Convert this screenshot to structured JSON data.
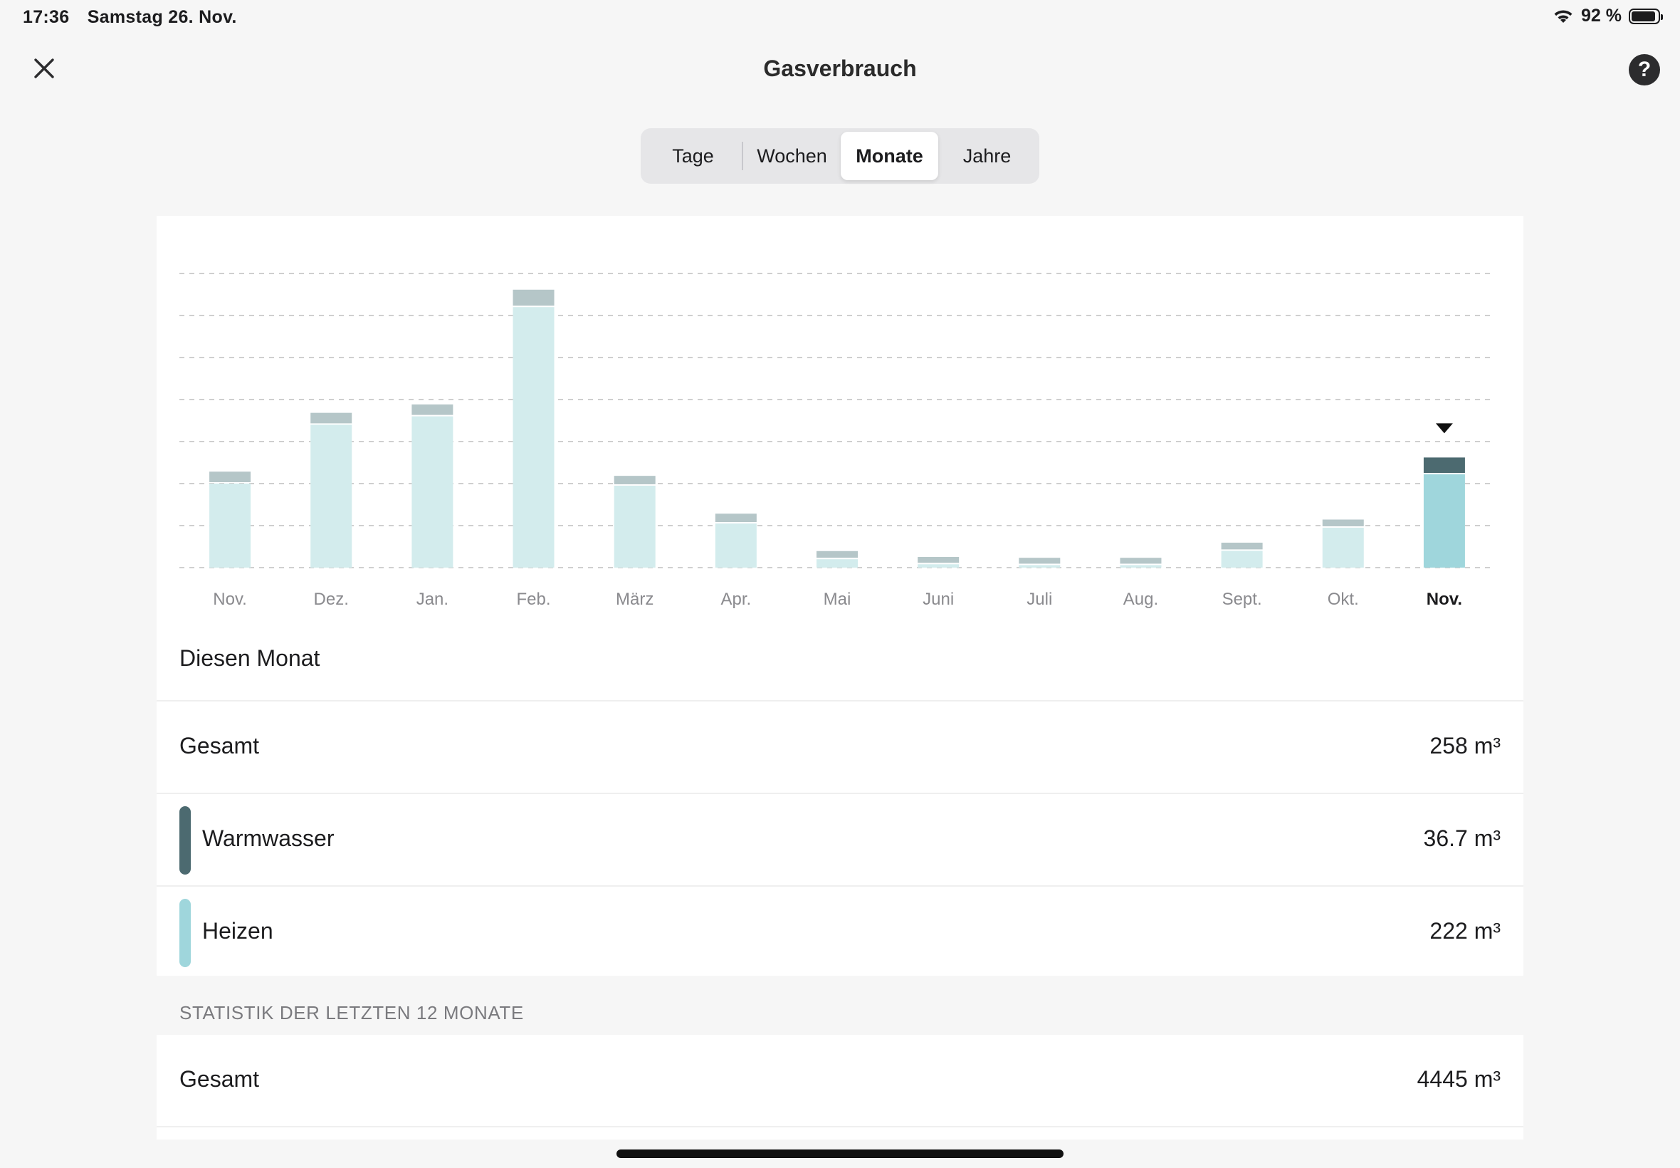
{
  "status": {
    "time": "17:36",
    "date": "Samstag 26. Nov.",
    "battery": "92 %",
    "battery_level": 0.92
  },
  "header": {
    "title": "Gasverbrauch",
    "close_icon": "close-icon",
    "help_icon": "question-circle-icon",
    "help_glyph": "?"
  },
  "segments": [
    {
      "label": "Tage",
      "active": false
    },
    {
      "label": "Wochen",
      "active": false
    },
    {
      "label": "Monate",
      "active": true
    },
    {
      "label": "Jahre",
      "active": false
    }
  ],
  "chart_data": {
    "type": "bar",
    "stacked": true,
    "categories": [
      "Nov.",
      "Dez.",
      "Jan.",
      "Feb.",
      "März",
      "Apr.",
      "Mai",
      "Juni",
      "Juli",
      "Aug.",
      "Sept.",
      "Okt.",
      "Nov."
    ],
    "selected_index": 12,
    "series": [
      {
        "values": [
          200,
          340,
          360,
          620,
          195,
          105,
          20,
          8,
          6,
          6,
          40,
          95,
          222
        ]
      },
      {
        "values": [
          25,
          25,
          25,
          38,
          20,
          20,
          16,
          14,
          14,
          14,
          16,
          16,
          36.7
        ]
      }
    ],
    "ylim": [
      0,
      700
    ],
    "grid": true,
    "gridlines": 8,
    "colors": {
      "heizen": "#d3eced",
      "warmwasser": "#b5c6c8",
      "heizen_selected": "#9fd6dc",
      "warmwasser_selected": "#4c6a70",
      "grid": "#cfcfcf",
      "tick": "#8a8a8e",
      "tick_selected": "#1c1c1e"
    }
  },
  "this_month": {
    "title": "Diesen Monat",
    "total": {
      "label": "Gesamt",
      "value": "258 m³"
    },
    "warmwasser": {
      "label": "Warmwasser",
      "value": "36.7 m³",
      "color": "#4c6a70"
    },
    "heizen": {
      "label": "Heizen",
      "value": "222 m³",
      "color": "#9fd6dc"
    }
  },
  "stats": {
    "header": "STATISTIK DER LETZTEN 12 MONATE",
    "total": {
      "label": "Gesamt",
      "value": "4445 m³"
    }
  }
}
